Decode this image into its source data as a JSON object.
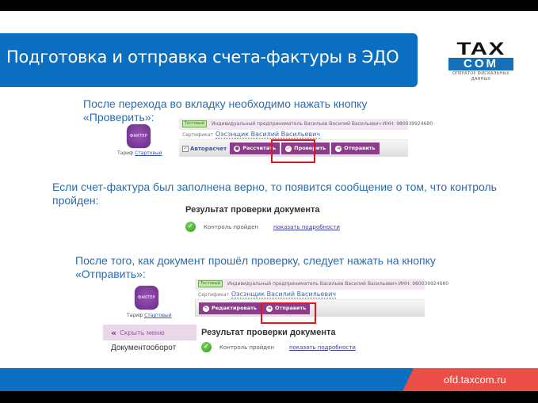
{
  "slide": {
    "title": "Подготовка и отправка счета-фактуры в ЭДО",
    "logo": {
      "line1": "TAX",
      "line2": "COM",
      "subtitle": "ОПЕРАТОР ФИСКАЛЬНЫХ ДАННЫХ"
    },
    "footer_url": "ofd.taxcom.ru",
    "colors": {
      "brand_blue": "#0a6fc0",
      "accent_red": "#ea4e46",
      "button_purple": "#8b3d8a",
      "highlight_red": "#e0161e",
      "text_blue": "#2a6cb0"
    }
  },
  "steps": [
    {
      "text": "После перехода во вкладку необходимо нажать кнопку «Проверить»:"
    },
    {
      "text": "Если счет-фактура был заполнена верно, то появится сообщение о том, что контроль пройден:"
    },
    {
      "text": "После того, как документ прошёл проверку, следует нажать на кнопку «Отправить»:"
    }
  ],
  "app": {
    "logo_text": "ФАКТЕР",
    "tarif_label": "Тариф",
    "tarif_value": "Стартовый",
    "badge": "Тестовый",
    "org": "Индивидуальный предприниматель Васильев Василий Васильевич ИНН: 980039924680",
    "cert_label": "Сертификат",
    "cert_name": "Оэсзнщик Василий Васильевич",
    "toolbar1": {
      "autocalc": "Авторасчет",
      "calc": "Рассчитать",
      "check": "Проверить",
      "send": "Отправить"
    },
    "toolbar2": {
      "edit": "Редактировать",
      "send": "Отправить"
    },
    "result": {
      "title": "Результат проверки документа",
      "status": "Контроль пройден",
      "details_link": "показать подробности"
    },
    "sidebar": {
      "hide_menu": "Скрыть меню",
      "documents": "Документооборот"
    }
  }
}
